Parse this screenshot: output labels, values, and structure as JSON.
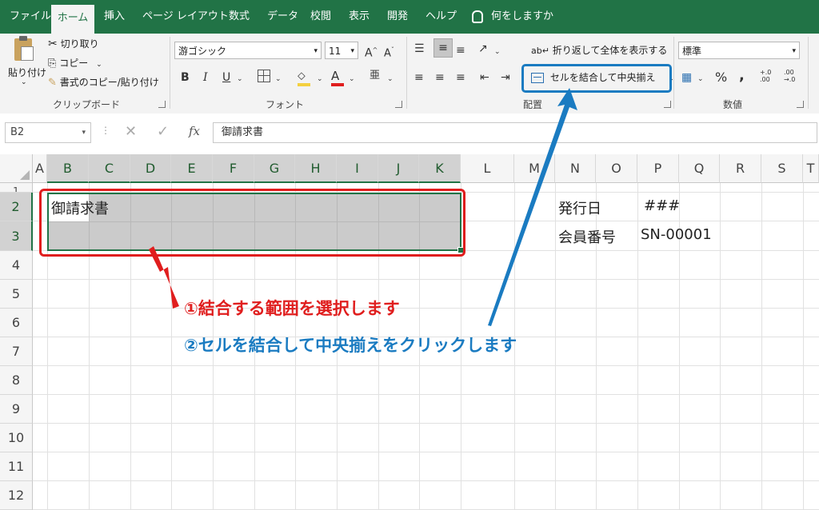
{
  "tabs": [
    {
      "label": "ファイル",
      "active": false
    },
    {
      "label": "ホーム",
      "active": true
    },
    {
      "label": "挿入",
      "active": false
    },
    {
      "label": "ページ レイアウト",
      "active": false
    },
    {
      "label": "数式",
      "active": false
    },
    {
      "label": "データ",
      "active": false
    },
    {
      "label": "校閲",
      "active": false
    },
    {
      "label": "表示",
      "active": false
    },
    {
      "label": "開発",
      "active": false
    },
    {
      "label": "ヘルプ",
      "active": false
    }
  ],
  "tell_me": "何をしますか",
  "ribbon": {
    "clipboard": {
      "paste": "貼り付け",
      "cut": "切り取り",
      "copy": "コピー",
      "format_painter": "書式のコピー/貼り付け",
      "group": "クリップボード"
    },
    "font": {
      "name": "游ゴシック",
      "size": "11",
      "bold": "B",
      "italic": "I",
      "underline": "U",
      "font_color_glyph": "A",
      "phonetic_glyph": "亜",
      "group": "フォント"
    },
    "alignment": {
      "wrap": "折り返して全体を表示する",
      "merge": "セルを結合して中央揃え",
      "group": "配置"
    },
    "number": {
      "format": "標準",
      "percent": "%",
      "comma": ",",
      "inc_decimal": "+.0 .00",
      "dec_decimal": ".00 →.0",
      "group": "数値"
    }
  },
  "formula_bar": {
    "name_box": "B2",
    "fx": "fx",
    "content": "御請求書"
  },
  "columns": [
    "A",
    "B",
    "C",
    "D",
    "E",
    "F",
    "G",
    "H",
    "I",
    "J",
    "K",
    "L",
    "M",
    "N",
    "O",
    "P",
    "Q",
    "R",
    "S",
    "T"
  ],
  "rows": [
    "1",
    "2",
    "3",
    "4",
    "5",
    "6",
    "7",
    "8",
    "9",
    "10",
    "11",
    "12"
  ],
  "cells": {
    "B2": "御請求書",
    "N2": "発行日",
    "P2": "###",
    "N3": "会員番号",
    "P3": "SN-00001"
  },
  "annotations": {
    "step1": "①結合する範囲を選択します",
    "step2": "②セルを結合して中央揃えをクリックします",
    "step1_color": "#e01e1e",
    "step2_color": "#1a7bc1"
  },
  "colors": {
    "excel_green": "#217346",
    "selection_fill": "#c8c8c8",
    "highlight_red": "#e01e1e",
    "highlight_blue": "#1a7bc1"
  }
}
